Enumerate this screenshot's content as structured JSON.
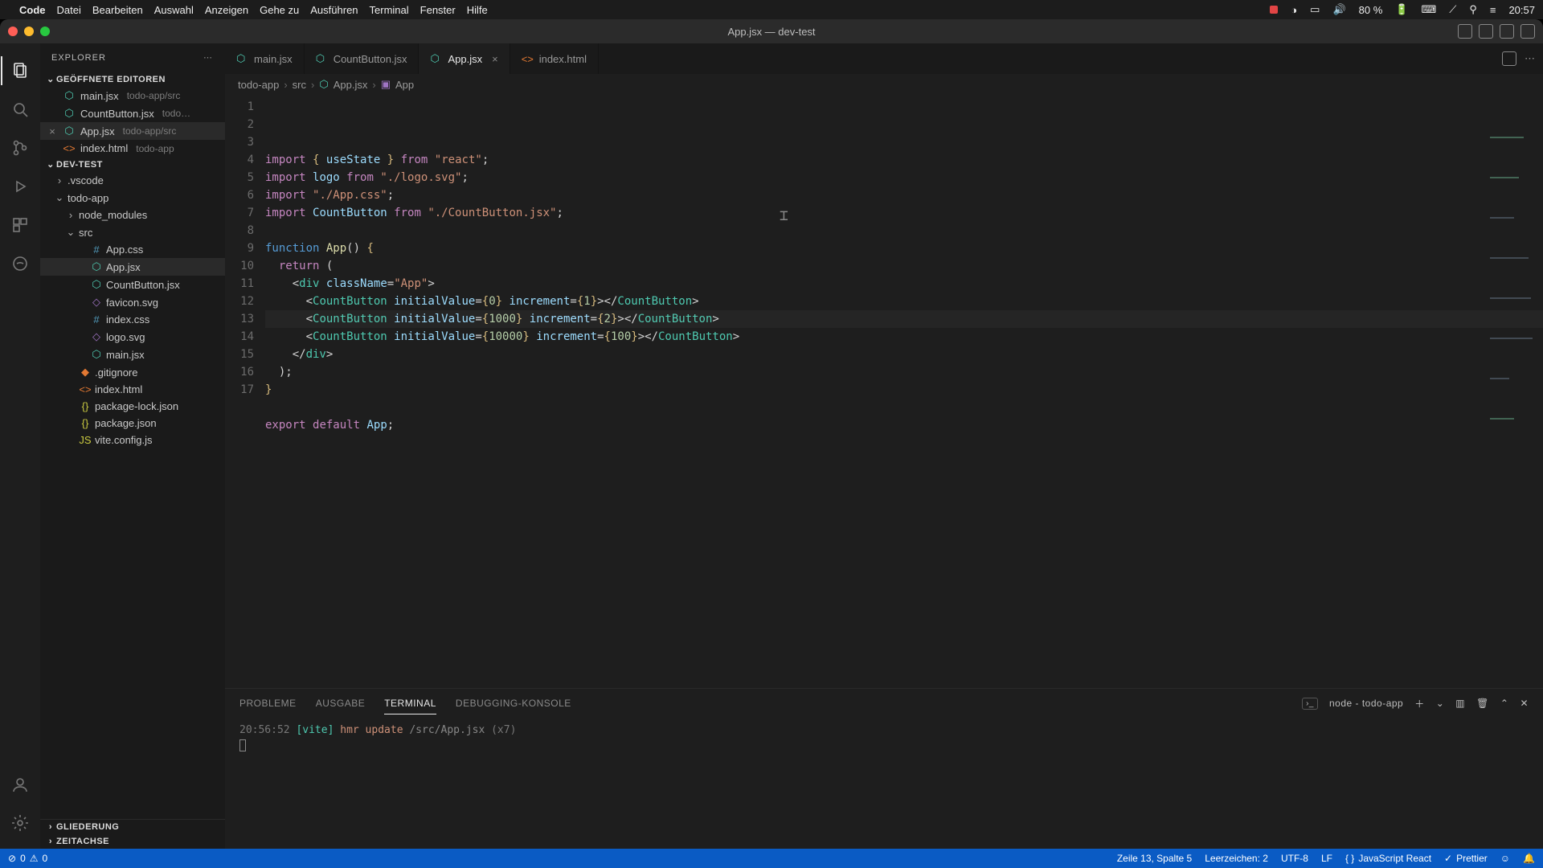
{
  "mac_menu": {
    "app": "Code",
    "items": [
      "Datei",
      "Bearbeiten",
      "Auswahl",
      "Anzeigen",
      "Gehe zu",
      "Ausführen",
      "Terminal",
      "Fenster",
      "Hilfe"
    ],
    "battery": "80 %",
    "clock": "20:57"
  },
  "window": {
    "title": "App.jsx — dev-test"
  },
  "sidebar": {
    "title": "EXPLORER",
    "open_editors_hd": "GEÖFFNETE EDITOREN",
    "open_editors": [
      {
        "name": "main.jsx",
        "hint": "todo-app/src",
        "icon": "react",
        "close": false
      },
      {
        "name": "CountButton.jsx",
        "hint": "todo…",
        "icon": "react",
        "close": false
      },
      {
        "name": "App.jsx",
        "hint": "todo-app/src",
        "icon": "react",
        "close": true,
        "active": true
      },
      {
        "name": "index.html",
        "hint": "todo-app",
        "icon": "html",
        "close": false
      }
    ],
    "project_hd": "DEV-TEST",
    "tree": [
      {
        "depth": 1,
        "type": "folder",
        "name": ".vscode",
        "open": false
      },
      {
        "depth": 1,
        "type": "folder",
        "name": "todo-app",
        "open": true
      },
      {
        "depth": 2,
        "type": "folder",
        "name": "node_modules",
        "open": false
      },
      {
        "depth": 2,
        "type": "folder",
        "name": "src",
        "open": true
      },
      {
        "depth": 3,
        "type": "file",
        "name": "App.css",
        "icon": "css"
      },
      {
        "depth": 3,
        "type": "file",
        "name": "App.jsx",
        "icon": "react",
        "active": true
      },
      {
        "depth": 3,
        "type": "file",
        "name": "CountButton.jsx",
        "icon": "react"
      },
      {
        "depth": 3,
        "type": "file",
        "name": "favicon.svg",
        "icon": "img"
      },
      {
        "depth": 3,
        "type": "file",
        "name": "index.css",
        "icon": "css"
      },
      {
        "depth": 3,
        "type": "file",
        "name": "logo.svg",
        "icon": "img"
      },
      {
        "depth": 3,
        "type": "file",
        "name": "main.jsx",
        "icon": "react"
      },
      {
        "depth": 2,
        "type": "file",
        "name": ".gitignore",
        "icon": "git"
      },
      {
        "depth": 2,
        "type": "file",
        "name": "index.html",
        "icon": "html"
      },
      {
        "depth": 2,
        "type": "file",
        "name": "package-lock.json",
        "icon": "json"
      },
      {
        "depth": 2,
        "type": "file",
        "name": "package.json",
        "icon": "json"
      },
      {
        "depth": 2,
        "type": "file",
        "name": "vite.config.js",
        "icon": "js"
      }
    ],
    "outline_hd": "GLIEDERUNG",
    "timeline_hd": "ZEITACHSE"
  },
  "tabs": {
    "items": [
      {
        "name": "main.jsx",
        "icon": "react"
      },
      {
        "name": "CountButton.jsx",
        "icon": "react"
      },
      {
        "name": "App.jsx",
        "icon": "react",
        "active": true,
        "close": true
      },
      {
        "name": "index.html",
        "icon": "html"
      }
    ]
  },
  "breadcrumb": {
    "parts": [
      "todo-app",
      "src",
      "App.jsx",
      "App"
    ]
  },
  "editor": {
    "active_line": 13,
    "lines": 17
  },
  "panel": {
    "tabs": [
      "PROBLEME",
      "AUSGABE",
      "TERMINAL",
      "DEBUGGING-KONSOLE"
    ],
    "active_tab": "TERMINAL",
    "proc": "node - todo-app",
    "terminal": {
      "time": "20:56:52",
      "tag": "[vite]",
      "action": "hmr update",
      "path": "/src/App.jsx",
      "count": "(x7)"
    }
  },
  "status": {
    "errors": "0",
    "warnings": "0",
    "position": "Zeile 13, Spalte 5",
    "indent": "Leerzeichen: 2",
    "encoding": "UTF-8",
    "eol": "LF",
    "lang": "JavaScript React",
    "formatter": "Prettier"
  }
}
